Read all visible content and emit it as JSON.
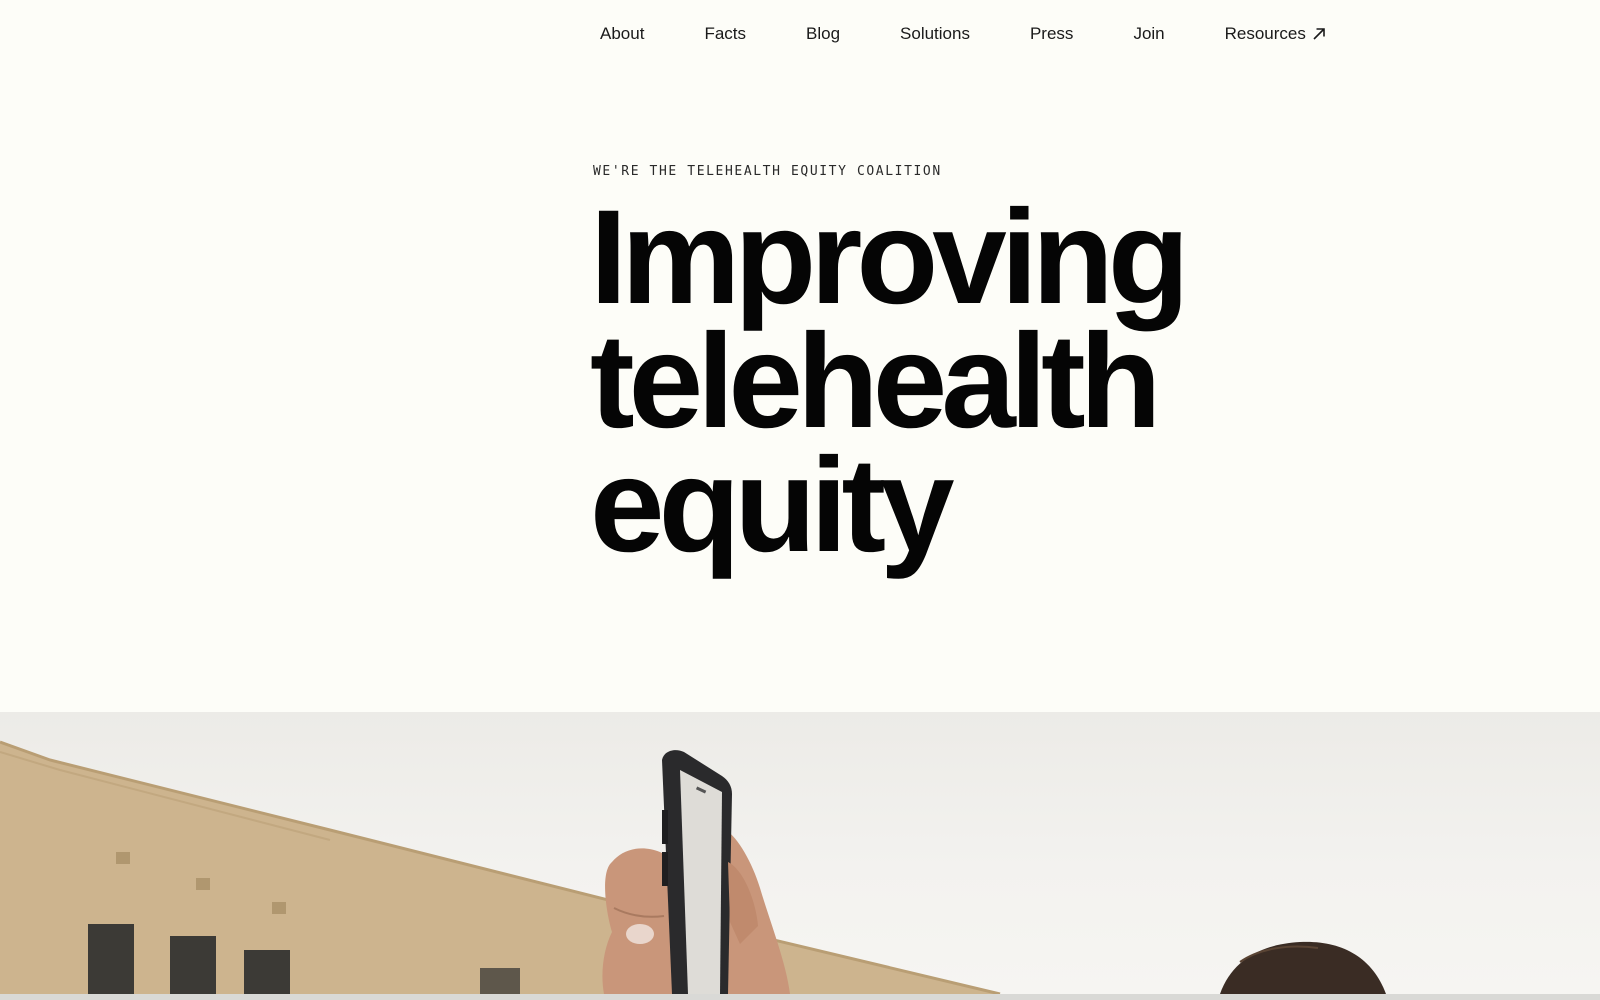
{
  "nav": {
    "items": [
      {
        "label": "About"
      },
      {
        "label": "Facts"
      },
      {
        "label": "Blog"
      },
      {
        "label": "Solutions"
      },
      {
        "label": "Press"
      },
      {
        "label": "Join"
      },
      {
        "label": "Resources",
        "icon": "arrow-up-right-icon"
      }
    ]
  },
  "hero": {
    "eyebrow": "WE'RE THE TELEHEALTH EQUITY COALITION",
    "headline_lines": [
      "Improving",
      "telehealth",
      "equity"
    ]
  },
  "photo": {
    "subject": "hand holding up a smartphone in front of a building",
    "icon": "hero-photo"
  },
  "colors": {
    "background": "#fdfdf8",
    "text": "#050505",
    "building": "#cdb48e"
  }
}
